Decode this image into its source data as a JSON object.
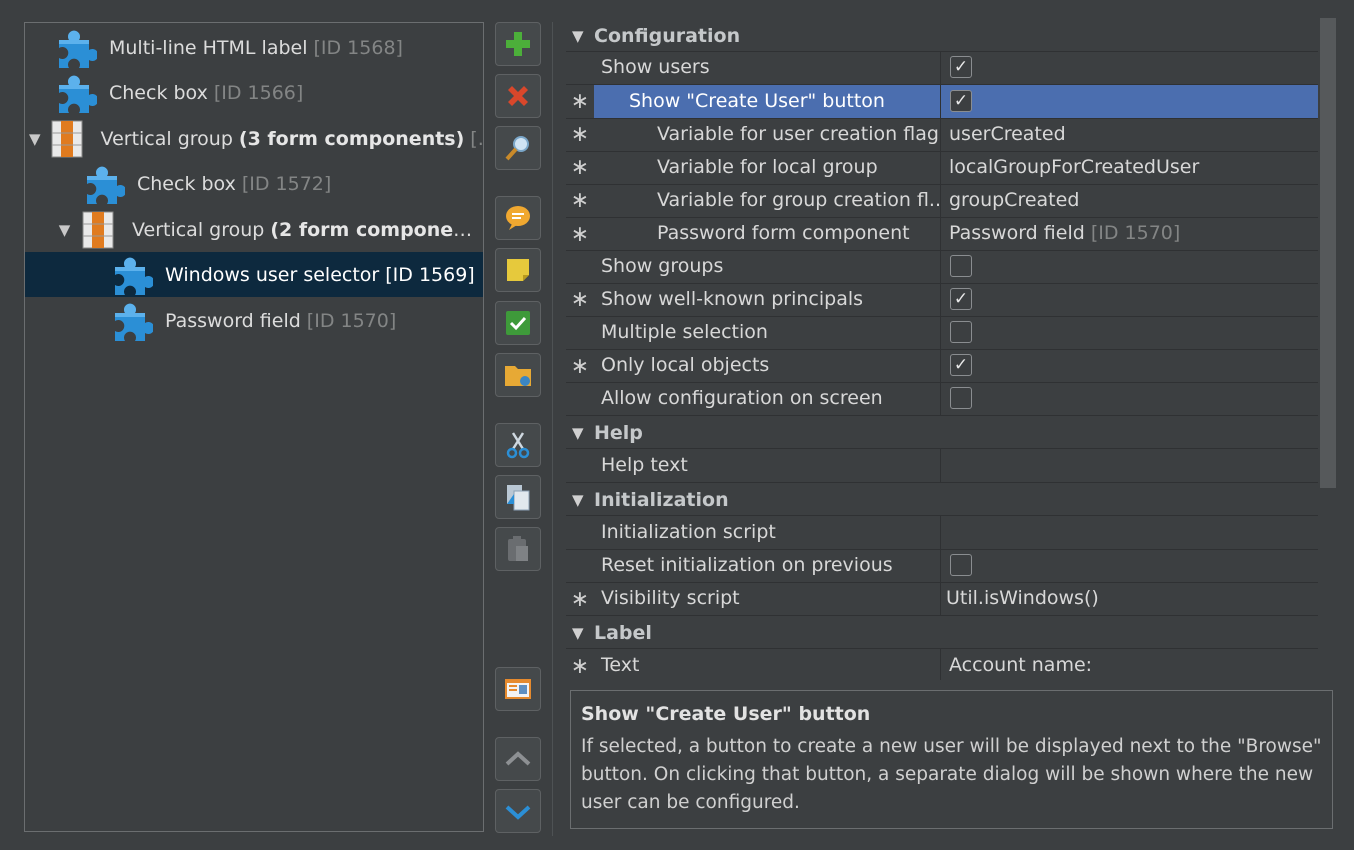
{
  "tree": {
    "items": [
      {
        "label": "Multi-line HTML label",
        "id_text": "[ID 1568]",
        "icon": "puzzle-piece-icon",
        "level": 0,
        "expander": ""
      },
      {
        "label": "Check box",
        "id_text": "[ID 1566]",
        "icon": "puzzle-piece-icon",
        "level": 0,
        "expander": ""
      },
      {
        "label": "Vertical group",
        "bold": "(3 form components)",
        "id_text": "[...",
        "icon": "vertical-group-icon",
        "level": 0,
        "expander": "▼"
      },
      {
        "label": "Check box",
        "id_text": "[ID 1572]",
        "icon": "puzzle-piece-icon",
        "level": 1,
        "expander": ""
      },
      {
        "label": "Vertical group",
        "bold": "(2 form component...",
        "id_text": "",
        "icon": "vertical-group-icon",
        "level": 1,
        "expander": "▼"
      },
      {
        "label": "Windows user selector [ID 1569]",
        "id_text": "",
        "icon": "puzzle-piece-icon",
        "level": 2,
        "expander": "",
        "selected": true
      },
      {
        "label": "Password field",
        "id_text": "[ID 1570]",
        "icon": "puzzle-piece-icon",
        "level": 2,
        "expander": ""
      }
    ]
  },
  "toolbar": {
    "buttons": [
      "add-icon",
      "delete-icon",
      "search-icon",
      "comment-icon",
      "note-icon",
      "check-icon",
      "folder-icon",
      "cut-icon",
      "copy-icon",
      "paste-icon",
      "preview-icon",
      "move-up-icon",
      "move-down-icon"
    ]
  },
  "props": {
    "sections": {
      "configuration": "Configuration",
      "help": "Help",
      "initialization": "Initialization",
      "label": "Label"
    },
    "rows": [
      {
        "name": "Show users",
        "checked": true,
        "star": false
      },
      {
        "name": "Show \"Create User\" button",
        "checked": true,
        "star": true,
        "selected": true
      },
      {
        "name": "Variable for user creation flag",
        "value": "userCreated",
        "star": true
      },
      {
        "name": "Variable for local group",
        "value": "localGroupForCreatedUser",
        "star": true
      },
      {
        "name": "Variable for group creation fl...",
        "value": "groupCreated",
        "star": true
      },
      {
        "name": "Password form component",
        "value": "Password field",
        "value_dim": "[ID 1570]",
        "star": true
      },
      {
        "name": "Show groups",
        "checked": false,
        "star": false
      },
      {
        "name": "Show well-known principals",
        "checked": true,
        "star": true
      },
      {
        "name": "Multiple selection",
        "checked": false,
        "star": false
      },
      {
        "name": "Only local objects",
        "checked": true,
        "star": true
      },
      {
        "name": "Allow configuration on screen",
        "checked": false,
        "star": false
      },
      {
        "name": "Help text",
        "value": "",
        "star": false
      },
      {
        "name": "Initialization script",
        "value": "",
        "star": false
      },
      {
        "name": "Reset initialization on previous",
        "checked": false,
        "star": false
      },
      {
        "name": "Visibility script",
        "value": "Util.isWindows()",
        "star": true
      },
      {
        "name": "Text",
        "value": "Account name:",
        "star": true
      }
    ],
    "star_glyph": "∗"
  },
  "description": {
    "title": "Show \"Create User\" button",
    "body": "If selected, a button to create a new user will be displayed next to the \"Browse\" button. On clicking that button, a separate dialog will be shown where the new user can be configured."
  }
}
